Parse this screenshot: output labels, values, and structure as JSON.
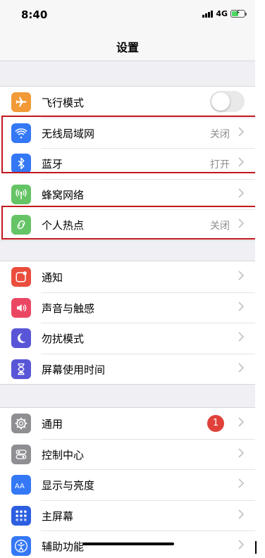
{
  "status_bar": {
    "time": "8:40",
    "network": "4G"
  },
  "nav": {
    "title": "设置"
  },
  "groups": [
    {
      "items": [
        {
          "label": "飞行模式",
          "icon": "airplane-icon",
          "color": "#f19a37",
          "toggle": false
        },
        {
          "label": "无线局域网",
          "value": "关闭",
          "icon": "wifi-icon",
          "color": "#3478f6"
        },
        {
          "label": "蓝牙",
          "value": "打开",
          "icon": "bluetooth-icon",
          "color": "#3478f6"
        },
        {
          "label": "蜂窝网络",
          "value": "",
          "icon": "cellular-icon",
          "color": "#65c466"
        },
        {
          "label": "个人热点",
          "value": "关闭",
          "icon": "hotspot-icon",
          "color": "#65c466"
        }
      ]
    },
    {
      "items": [
        {
          "label": "通知",
          "icon": "notifications-icon",
          "color": "#eb4d3d"
        },
        {
          "label": "声音与触感",
          "icon": "sound-icon",
          "color": "#eb4763"
        },
        {
          "label": "勿扰模式",
          "icon": "moon-icon",
          "color": "#5856d6"
        },
        {
          "label": "屏幕使用时间",
          "icon": "hourglass-icon",
          "color": "#5856d6"
        }
      ]
    },
    {
      "items": [
        {
          "label": "通用",
          "badge": "1",
          "icon": "gear-icon",
          "color": "#8e8e93"
        },
        {
          "label": "控制中心",
          "icon": "toggles-icon",
          "color": "#8e8e93"
        },
        {
          "label": "显示与亮度",
          "icon": "display-icon",
          "color": "#3478f6"
        },
        {
          "label": "主屏幕",
          "icon": "home-screen-icon",
          "color": "#2c5ee0"
        },
        {
          "label": "辅助功能",
          "icon": "accessibility-icon",
          "color": "#3478f6"
        }
      ]
    }
  ],
  "highlight_color": "#c3171f"
}
